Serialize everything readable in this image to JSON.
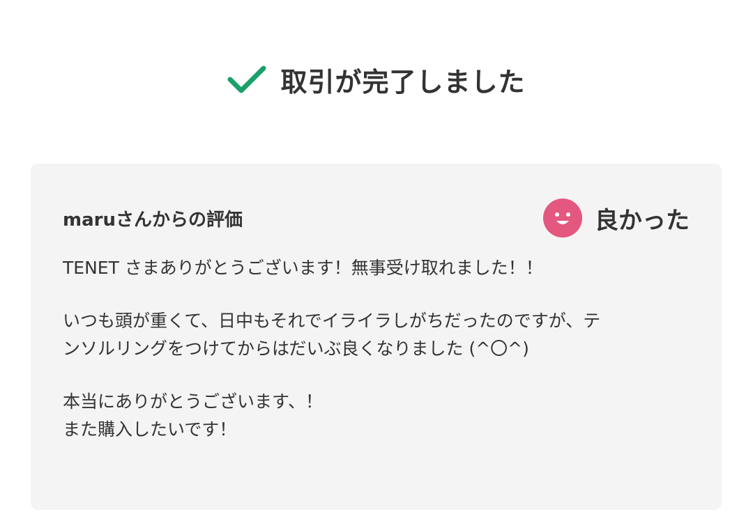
{
  "header": {
    "icon": "checkmark-icon",
    "title": "取引が完了しました",
    "check_color": "#1aa06a"
  },
  "review": {
    "reviewer_label": "maruさんからの評価",
    "rating_icon": "smile-icon",
    "rating_color": "#e4577f",
    "rating_label": "良かった",
    "message": {
      "para1_line1": "TENET さまありがとうございます！無事受け取れました！！",
      "para2_line1": "いつも頭が重くて、日中もそれでイライラしがちだったのですが、テ",
      "para2_line2": "ンソルリングをつけてからはだいぶ良くなりました (^〇^)",
      "para3_line1": "本当にありがとうございます、！",
      "para3_line2": "また購入したいです！"
    }
  }
}
